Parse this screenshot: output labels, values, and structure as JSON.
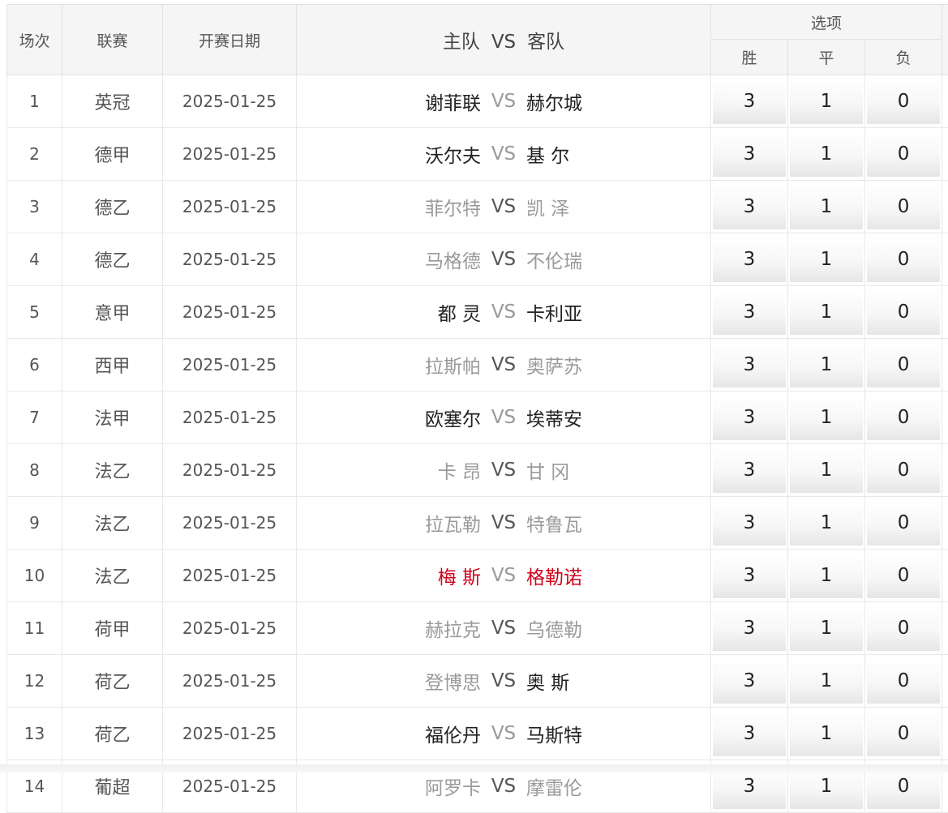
{
  "header": {
    "no": "场次",
    "league": "联赛",
    "date": "开赛日期",
    "home": "主队",
    "vs": "VS",
    "away": "客队",
    "options": "选项",
    "win": "胜",
    "draw": "平",
    "loss": "负"
  },
  "rows": [
    {
      "no": "1",
      "league": "英冠",
      "date": "2025-01-25",
      "home": "谢菲联",
      "vs": "VS",
      "away": "赫尔城",
      "win": "3",
      "draw": "1",
      "loss": "0"
    },
    {
      "no": "2",
      "league": "德甲",
      "date": "2025-01-25",
      "home": "沃尔夫",
      "vs": "VS",
      "away": "基 尔",
      "win": "3",
      "draw": "1",
      "loss": "0"
    },
    {
      "no": "3",
      "league": "德乙",
      "date": "2025-01-25",
      "home": "菲尔特",
      "vs": "VS",
      "away": "凯 泽",
      "win": "3",
      "draw": "1",
      "loss": "0"
    },
    {
      "no": "4",
      "league": "德乙",
      "date": "2025-01-25",
      "home": "马格德",
      "vs": "VS",
      "away": "不伦瑞",
      "win": "3",
      "draw": "1",
      "loss": "0"
    },
    {
      "no": "5",
      "league": "意甲",
      "date": "2025-01-25",
      "home": "都 灵",
      "vs": "VS",
      "away": "卡利亚",
      "win": "3",
      "draw": "1",
      "loss": "0"
    },
    {
      "no": "6",
      "league": "西甲",
      "date": "2025-01-25",
      "home": "拉斯帕",
      "vs": "VS",
      "away": "奥萨苏",
      "win": "3",
      "draw": "1",
      "loss": "0"
    },
    {
      "no": "7",
      "league": "法甲",
      "date": "2025-01-25",
      "home": "欧塞尔",
      "vs": "VS",
      "away": "埃蒂安",
      "win": "3",
      "draw": "1",
      "loss": "0"
    },
    {
      "no": "8",
      "league": "法乙",
      "date": "2025-01-25",
      "home": "卡 昂",
      "vs": "VS",
      "away": "甘 冈",
      "win": "3",
      "draw": "1",
      "loss": "0"
    },
    {
      "no": "9",
      "league": "法乙",
      "date": "2025-01-25",
      "home": "拉瓦勒",
      "vs": "VS",
      "away": "特鲁瓦",
      "win": "3",
      "draw": "1",
      "loss": "0"
    },
    {
      "no": "10",
      "league": "法乙",
      "date": "2025-01-25",
      "home": "梅 斯",
      "vs": "VS",
      "away": "格勒诺",
      "win": "3",
      "draw": "1",
      "loss": "0"
    },
    {
      "no": "11",
      "league": "荷甲",
      "date": "2025-01-25",
      "home": "赫拉克",
      "vs": "VS",
      "away": "乌德勒",
      "win": "3",
      "draw": "1",
      "loss": "0"
    },
    {
      "no": "12",
      "league": "荷乙",
      "date": "2025-01-25",
      "home": "登博思",
      "vs": "VS",
      "away": "奥 斯",
      "win": "3",
      "draw": "1",
      "loss": "0"
    },
    {
      "no": "13",
      "league": "荷乙",
      "date": "2025-01-25",
      "home": "福伦丹",
      "vs": "VS",
      "away": "马斯特",
      "win": "3",
      "draw": "1",
      "loss": "0"
    },
    {
      "no": "14",
      "league": "葡超",
      "date": "2025-01-25",
      "home": "阿罗卡",
      "vs": "VS",
      "away": "摩雷伦",
      "win": "3",
      "draw": "1",
      "loss": "0"
    }
  ],
  "colors": {
    "text_dark": "#222222",
    "text_grey": "#9a9a9a",
    "text_red": "#d0021b",
    "header_bg": "#f5f5f5",
    "border": "#e2e2e2"
  }
}
